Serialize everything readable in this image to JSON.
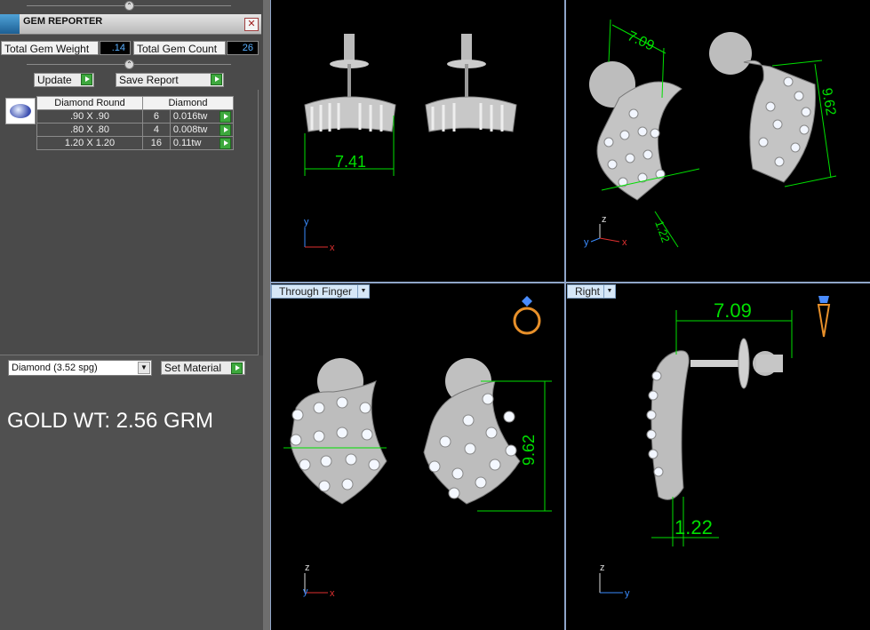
{
  "panel": {
    "title": "GEM REPORTER",
    "close_label": "✕",
    "total_weight_label": "Total Gem Weight",
    "total_weight_value": ".14",
    "total_count_label": "Total Gem Count",
    "total_count_value": "26",
    "update_label": "Update",
    "save_label": "Save Report",
    "table": {
      "headers": [
        "Diamond Round",
        "Diamond"
      ],
      "rows": [
        {
          "size": ".90 X .90",
          "count": "6",
          "weight": "0.016tw"
        },
        {
          "size": ".80 X .80",
          "count": "4",
          "weight": "0.008tw"
        },
        {
          "size": "1.20 X 1.20",
          "count": "16",
          "weight": "0.11tw"
        }
      ]
    },
    "material_select": "Diamond    (3.52 spg)",
    "set_material_label": "Set Material",
    "gold_weight": "GOLD WT: 2.56 GRM"
  },
  "viewports": {
    "top_left": {
      "dimension": "7.41",
      "axes": [
        "y",
        "x"
      ]
    },
    "top_right": {
      "dimensions": [
        "7.09",
        "9.62",
        "1.22"
      ],
      "axes": [
        "z",
        "y",
        "x"
      ]
    },
    "bottom_left": {
      "tab": "Through Finger",
      "dimension": "9.62",
      "axes": [
        "z",
        "y",
        "x"
      ],
      "icon": "ring-icon"
    },
    "bottom_right": {
      "tab": "Right",
      "dimensions": [
        "7.09",
        "1.22"
      ],
      "axes": [
        "z",
        "y"
      ],
      "icon": "pendant-icon"
    }
  },
  "colors": {
    "dimension": "#00e000",
    "axis_x": "#e03030",
    "axis_y": "#3a8cff",
    "axis_z": "#dddddd",
    "tab": "#d6e7f7"
  }
}
